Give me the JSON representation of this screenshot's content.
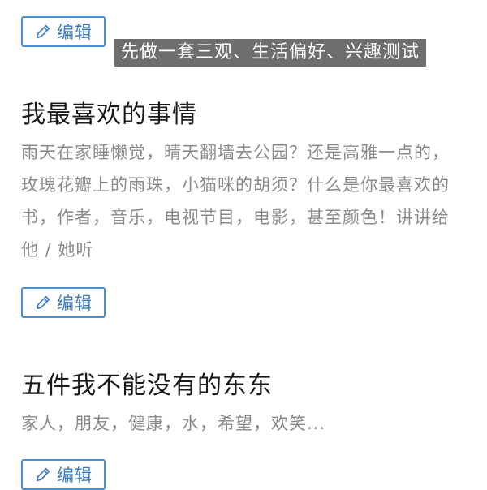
{
  "overlay_caption": "先做一套三观、生活偏好、兴趣测试",
  "edit_label": "编辑",
  "sections": [
    {
      "title": "我最喜欢的事情",
      "description": "雨天在家睡懒觉，晴天翻墙去公园？还是高雅一点的，玫瑰花瓣上的雨珠，小猫咪的胡须？什么是你最喜欢的书，作者，音乐，电视节目，电影，甚至颜色！讲讲给他 / 她听"
    },
    {
      "title": "五件我不能没有的东东",
      "description": "家人，朋友，健康，水，希望，欢笑..."
    }
  ],
  "icons": {
    "edit": "pencil-icon"
  },
  "colors": {
    "accent": "#3a7cc4",
    "border": "#4a8fcf",
    "caption_bg": "#6e6e6e",
    "desc_text": "#8a8a8a"
  }
}
